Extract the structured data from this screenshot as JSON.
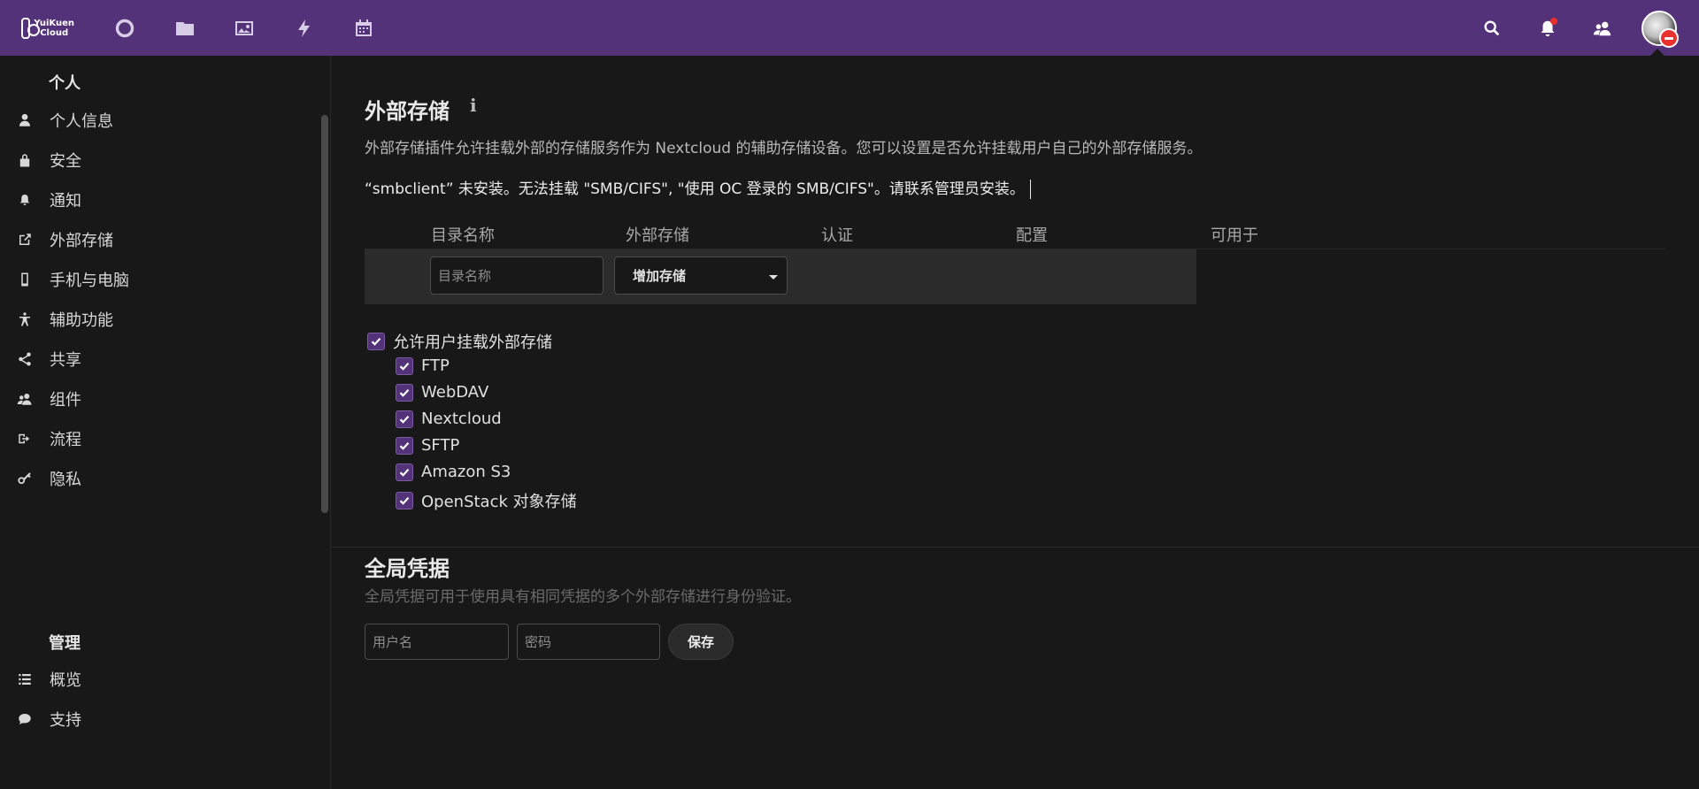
{
  "header": {
    "logo_line1": "YuiKuen",
    "logo_line2": "Cloud",
    "apps": [
      "dashboard-icon",
      "files-icon",
      "photos-icon",
      "activity-icon",
      "calendar-icon"
    ],
    "right_icons": [
      "search-icon",
      "notifications-icon",
      "contacts-icon"
    ],
    "accent": "#54327a"
  },
  "sidebar": {
    "personal_caption": "个人",
    "personal_items": [
      {
        "label": "个人信息",
        "icon": "user-icon"
      },
      {
        "label": "安全",
        "icon": "lock-icon"
      },
      {
        "label": "通知",
        "icon": "bell-icon"
      },
      {
        "label": "外部存储",
        "icon": "external-link-icon"
      },
      {
        "label": "手机与电脑",
        "icon": "phone-icon"
      },
      {
        "label": "辅助功能",
        "icon": "accessibility-icon"
      },
      {
        "label": "共享",
        "icon": "share-icon"
      },
      {
        "label": "组件",
        "icon": "group-icon"
      },
      {
        "label": "流程",
        "icon": "flow-icon"
      },
      {
        "label": "隐私",
        "icon": "key-icon"
      }
    ],
    "admin_caption": "管理",
    "admin_items": [
      {
        "label": "概览",
        "icon": "list-icon"
      },
      {
        "label": "支持",
        "icon": "chat-icon"
      }
    ]
  },
  "external_storage": {
    "title": "外部存储",
    "info_glyph": "i",
    "description": "外部存储插件允许挂载外部的存储服务作为 Nextcloud 的辅助存储设备。您可以设置是否允许挂载用户自己的外部存储服务。",
    "warning": "“smbclient” 未安装。无法挂载 \"SMB/CIFS\", \"使用 OC 登录的 SMB/CIFS\"。请联系管理员安装。",
    "columns": [
      "目录名称",
      "外部存储",
      "认证",
      "配置",
      "可用于"
    ],
    "folder_placeholder": "目录名称",
    "add_storage_label": "增加存储",
    "allow_user_mount_label": "允许用户挂载外部存储",
    "backends": [
      "FTP",
      "WebDAV",
      "Nextcloud",
      "SFTP",
      "Amazon S3",
      "OpenStack 对象存储"
    ]
  },
  "global_credentials": {
    "title": "全局凭据",
    "description": "全局凭据可用于使用具有相同凭据的多个外部存储进行身份验证。",
    "username_placeholder": "用户名",
    "password_placeholder": "密码",
    "save_label": "保存"
  }
}
